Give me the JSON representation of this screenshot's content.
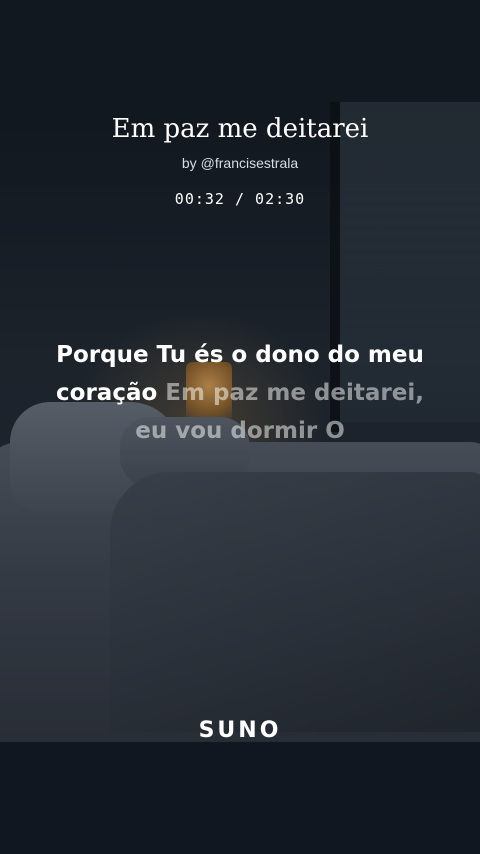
{
  "song": {
    "title": "Em paz me deitarei",
    "byline_prefix": "by",
    "artist": "@francisestrala",
    "time_display": "00:32 / 02:30"
  },
  "lyrics": {
    "active": "Porque Tu és o dono do meu coração",
    "upcoming": "Em paz me deitarei, eu vou dormir O"
  },
  "brand": {
    "logo_text": "SUNO"
  },
  "colors": {
    "background": "#10151c",
    "text": "#ffffff",
    "upcoming_text": "rgba(255,255,255,0.5)"
  }
}
